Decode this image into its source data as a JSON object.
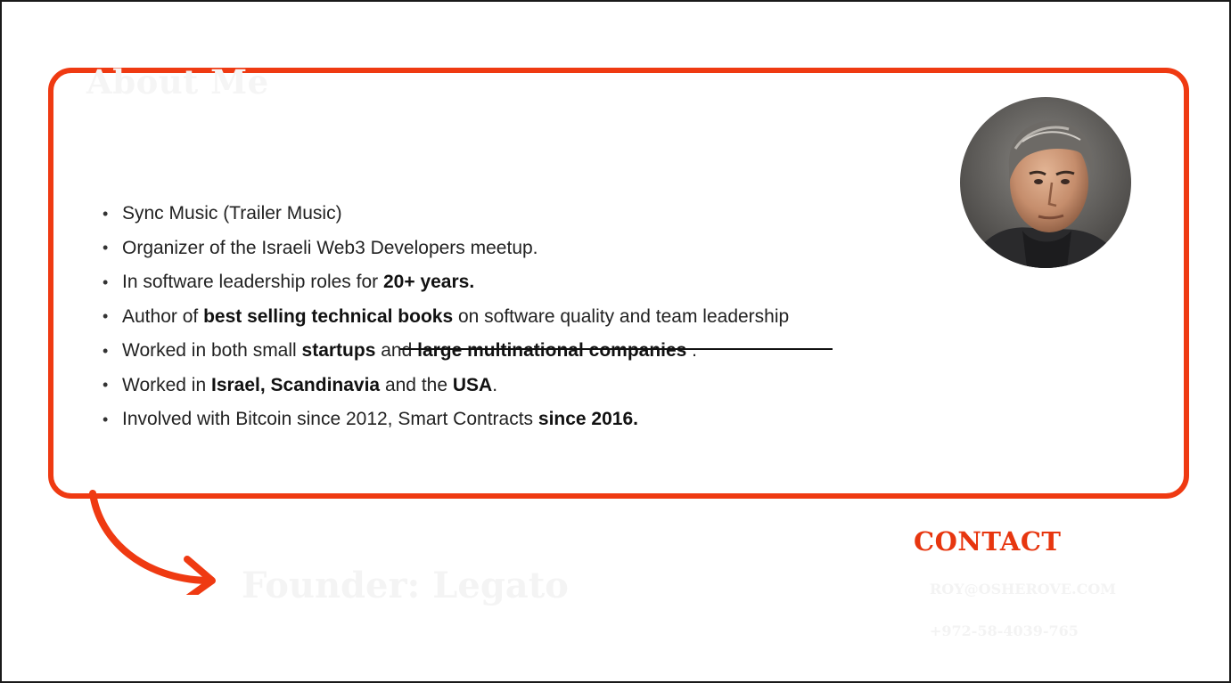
{
  "slide": {
    "accent_color": "#ef3a12",
    "title": "About Me",
    "bullets": [
      {
        "parts": [
          {
            "text": "Sync Music (Trailer Music)",
            "bold": false
          }
        ]
      },
      {
        "parts": [
          {
            "text": "Organizer of the Israeli Web3 Developers meetup.",
            "bold": false
          }
        ]
      },
      {
        "parts": [
          {
            "text": "In software leadership roles for ",
            "bold": false
          },
          {
            "text": "20+ years.",
            "bold": true
          }
        ]
      },
      {
        "parts": [
          {
            "text": "Author of ",
            "bold": false
          },
          {
            "text": "best selling technical books",
            "bold": true
          },
          {
            "text": " on software quality and team leadership",
            "bold": false
          }
        ]
      },
      {
        "parts": [
          {
            "text": "Worked in both small ",
            "bold": false
          },
          {
            "text": "startups",
            "bold": true
          },
          {
            "text": " and ",
            "bold": false
          },
          {
            "text": "large multinational companies",
            "bold": true
          },
          {
            "text": " .",
            "bold": false
          }
        ]
      },
      {
        "parts": [
          {
            "text": "Worked in ",
            "bold": false
          },
          {
            "text": "Israel, Scandinavia",
            "bold": true
          },
          {
            "text": " and the ",
            "bold": false
          },
          {
            "text": "USA",
            "bold": true
          },
          {
            "text": ".",
            "bold": false
          }
        ]
      },
      {
        "parts": [
          {
            "text": "Involved with Bitcoin since 2012, Smart Contracts ",
            "bold": false
          },
          {
            "text": "since 2016.",
            "bold": true
          }
        ]
      }
    ],
    "founder_text": "Founder: Legato",
    "contact": {
      "heading": "CONTACT",
      "email": "ROY@OSHEROVE.COM",
      "phone": "+972-58-4039-765"
    },
    "icons": {
      "avatar": "profile-photo",
      "arrow": "curved-arrow-icon",
      "bullet": "•"
    }
  }
}
